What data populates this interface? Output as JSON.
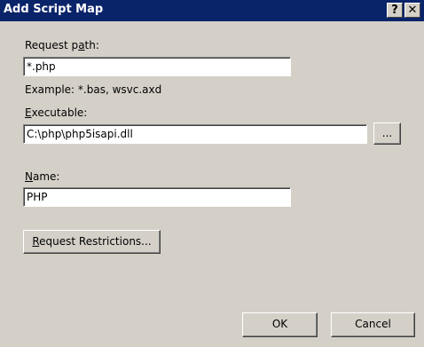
{
  "window": {
    "title": "Add Script Map",
    "help_glyph": "?",
    "close_glyph": "✕"
  },
  "request_path": {
    "label_mnemonic": "Request p",
    "label_key": "a",
    "label_rest": "th:",
    "value": "*.php",
    "example": "Example: *.bas, wsvc.axd"
  },
  "executable": {
    "label_key": "E",
    "label_rest": "xecutable:",
    "value": "C:\\php\\php5isapi.dll",
    "browse_label": "..."
  },
  "name": {
    "label_key": "N",
    "label_rest": "ame:",
    "value": "PHP"
  },
  "request_restrictions_button": {
    "label_key": "R",
    "label_rest": "equest Restrictions..."
  },
  "buttons": {
    "ok": "OK",
    "cancel": "Cancel"
  }
}
